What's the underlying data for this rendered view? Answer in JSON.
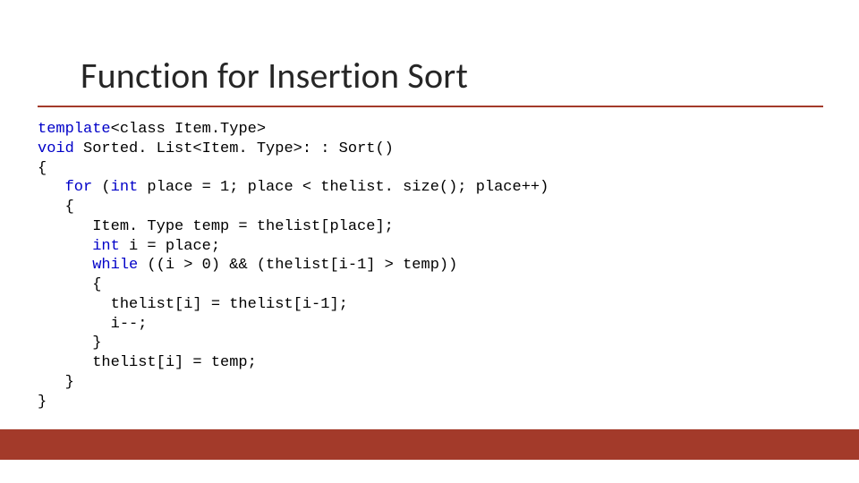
{
  "title": "Function for Insertion Sort",
  "code": {
    "kw1": "template",
    "l1rest": "<class Item.Type>",
    "kw2": "void",
    "l2rest": " Sorted. List<Item. Type>: : Sort()",
    "l3": "{",
    "kw4": "for",
    "l4a": " (",
    "kw4b": "int",
    "l4rest": " place = 1; place < thelist. size(); place++)",
    "l5": "   {",
    "l6": "      Item. Type temp = thelist[place];",
    "kw7": "int",
    "l7rest": " i = place;",
    "kw8": "while",
    "l8rest": " ((i > 0) && (thelist[i-1] > temp))",
    "l9": "      {",
    "l10": "        thelist[i] = thelist[i-1];",
    "l11": "        i--;",
    "l12": "      }",
    "l13": "      thelist[i] = temp;",
    "l14": "   }",
    "l15": "}"
  }
}
